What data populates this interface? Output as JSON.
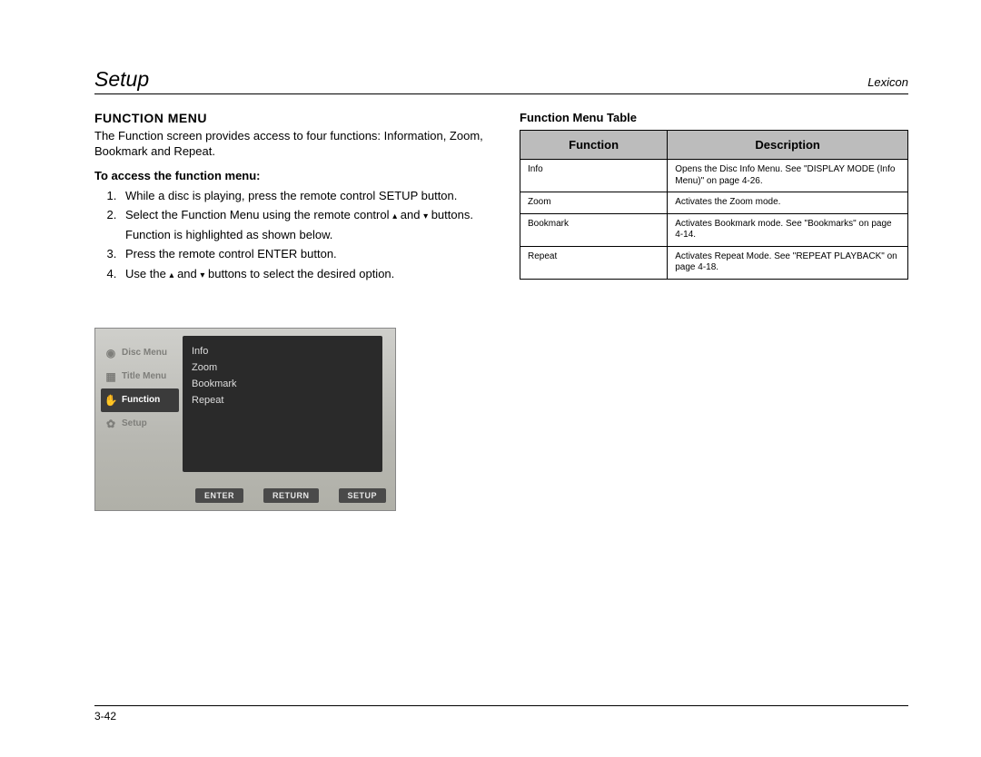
{
  "header": {
    "left": "Setup",
    "right": "Lexicon"
  },
  "left_col": {
    "title": "FUNCTION MENU",
    "intro": "The Function screen provides access to four functions: Information, Zoom, Bookmark and Repeat.",
    "access_heading": "To access the function menu:",
    "step1": "While a disc is playing, press the remote control SETUP button.",
    "step2a": "Select the Function Menu using the remote control ",
    "step2b": " and ",
    "step2c": " buttons.",
    "step2_note": "Function is highlighted as shown below.",
    "step3": "Press the remote control ENTER button.",
    "step4a": "Use the ",
    "step4b": " and ",
    "step4c": " buttons to select the desired option."
  },
  "osd": {
    "side": {
      "disc": "Disc Menu",
      "title": "Title Menu",
      "function": "Function",
      "setup": "Setup"
    },
    "panel": {
      "r0": "Info",
      "r1": "Zoom",
      "r2": "Bookmark",
      "r3": "Repeat"
    },
    "buttons": {
      "enter": "ENTER",
      "return": "RETURN",
      "setup": "SETUP"
    }
  },
  "right_col": {
    "table_heading": "Function Menu Table",
    "th_function": "Function",
    "th_description": "Description",
    "rows": [
      {
        "f": "Info",
        "d": "Opens the Disc Info Menu. See \"DISPLAY MODE (Info Menu)\" on page 4-26."
      },
      {
        "f": "Zoom",
        "d": "Activates the Zoom mode."
      },
      {
        "f": "Bookmark",
        "d": "Activates Bookmark mode. See \"Bookmarks\" on page 4-14."
      },
      {
        "f": "Repeat",
        "d": "Activates Repeat Mode. See \"REPEAT PLAYBACK\" on page 4-18."
      }
    ]
  },
  "page_number": "3-42"
}
